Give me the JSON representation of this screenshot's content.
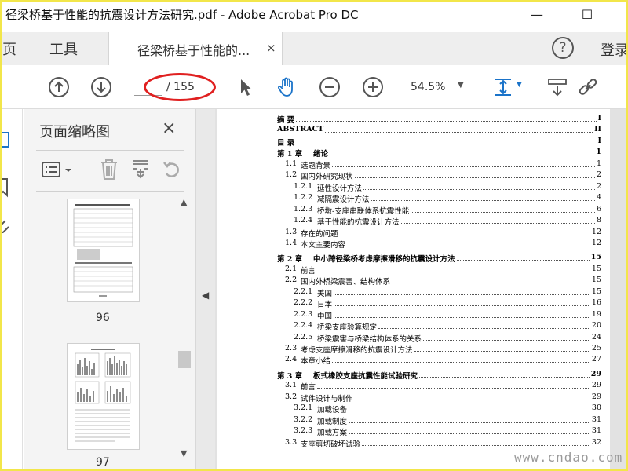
{
  "window": {
    "title": "径梁桥基于性能的抗震设计方法研究.pdf - Adobe Acrobat Pro DC",
    "minimize": "—",
    "maximize": "☐"
  },
  "tabs": {
    "home": "主页",
    "tools": "工具",
    "document": "径梁桥基于性能的...",
    "close": "×",
    "help": "?",
    "login": "登录"
  },
  "toolbar": {
    "page_current": "",
    "page_total": "/ 155",
    "zoom": "54.5%"
  },
  "thumbnails": {
    "heading": "页面缩略图",
    "close": "×",
    "pages": [
      {
        "number": "96"
      },
      {
        "number": "97"
      }
    ]
  },
  "toc": [
    {
      "num": "",
      "text": "摘  要",
      "page": "I",
      "level": 0,
      "bold": true
    },
    {
      "num": "",
      "text": "ABSTRACT",
      "page": "II",
      "level": 0,
      "bold": true
    },
    {
      "num": "",
      "text": "目  录",
      "page": "I",
      "level": 0,
      "bold": true
    },
    {
      "num": "第 1 章",
      "text": "绪论",
      "page": "1",
      "level": 0,
      "bold": true
    },
    {
      "num": "1.1",
      "text": "选题背景",
      "page": "1",
      "level": 1,
      "bold": false
    },
    {
      "num": "1.2",
      "text": "国内外研究现状",
      "page": "2",
      "level": 1,
      "bold": false
    },
    {
      "num": "1.2.1",
      "text": "延性设计方法",
      "page": "2",
      "level": 2,
      "bold": false
    },
    {
      "num": "1.2.2",
      "text": "减隔震设计方法",
      "page": "4",
      "level": 2,
      "bold": false
    },
    {
      "num": "1.2.3",
      "text": "桥墩-支座串联体系抗震性能",
      "page": "6",
      "level": 2,
      "bold": false
    },
    {
      "num": "1.2.4",
      "text": "基于性能的抗震设计方法",
      "page": "8",
      "level": 2,
      "bold": false
    },
    {
      "num": "1.3",
      "text": "存在的问题",
      "page": "12",
      "level": 1,
      "bold": false
    },
    {
      "num": "1.4",
      "text": "本文主要内容",
      "page": "12",
      "level": 1,
      "bold": false
    },
    {
      "num": "第 2 章",
      "text": "中小跨径梁桥考虑摩擦滑移的抗震设计方法",
      "page": "15",
      "level": 0,
      "bold": true
    },
    {
      "num": "2.1",
      "text": "前言",
      "page": "15",
      "level": 1,
      "bold": false
    },
    {
      "num": "2.2",
      "text": "国内外桥梁震害、结构体系",
      "page": "15",
      "level": 1,
      "bold": false
    },
    {
      "num": "2.2.1",
      "text": "美国",
      "page": "15",
      "level": 2,
      "bold": false
    },
    {
      "num": "2.2.2",
      "text": "日本",
      "page": "16",
      "level": 2,
      "bold": false
    },
    {
      "num": "2.2.3",
      "text": "中国",
      "page": "19",
      "level": 2,
      "bold": false
    },
    {
      "num": "2.2.4",
      "text": "桥梁支座验算规定",
      "page": "20",
      "level": 2,
      "bold": false
    },
    {
      "num": "2.2.5",
      "text": "桥梁震害与桥梁结构体系的关系",
      "page": "24",
      "level": 2,
      "bold": false
    },
    {
      "num": "2.3",
      "text": "考虑支座摩擦滑移的抗震设计方法",
      "page": "25",
      "level": 1,
      "bold": false
    },
    {
      "num": "2.4",
      "text": "本章小结",
      "page": "27",
      "level": 1,
      "bold": false
    },
    {
      "num": "第 3 章",
      "text": "板式橡胶支座抗震性能试验研究",
      "page": "29",
      "level": 0,
      "bold": true
    },
    {
      "num": "3.1",
      "text": "前言",
      "page": "29",
      "level": 1,
      "bold": false
    },
    {
      "num": "3.2",
      "text": "试件设计与制作",
      "page": "29",
      "level": 1,
      "bold": false
    },
    {
      "num": "3.2.1",
      "text": "加载设备",
      "page": "30",
      "level": 2,
      "bold": false
    },
    {
      "num": "3.2.2",
      "text": "加载制度",
      "page": "31",
      "level": 2,
      "bold": false
    },
    {
      "num": "3.2.3",
      "text": "加载方案",
      "page": "31",
      "level": 2,
      "bold": false
    },
    {
      "num": "3.3",
      "text": "支座剪切破坏试验",
      "page": "32",
      "level": 1,
      "bold": false
    }
  ],
  "watermark": "www.cndao.com",
  "colors": {
    "accent": "#1a73c9",
    "highlight_ellipse": "#e02020",
    "screenshot_border": "#f2e64a"
  }
}
